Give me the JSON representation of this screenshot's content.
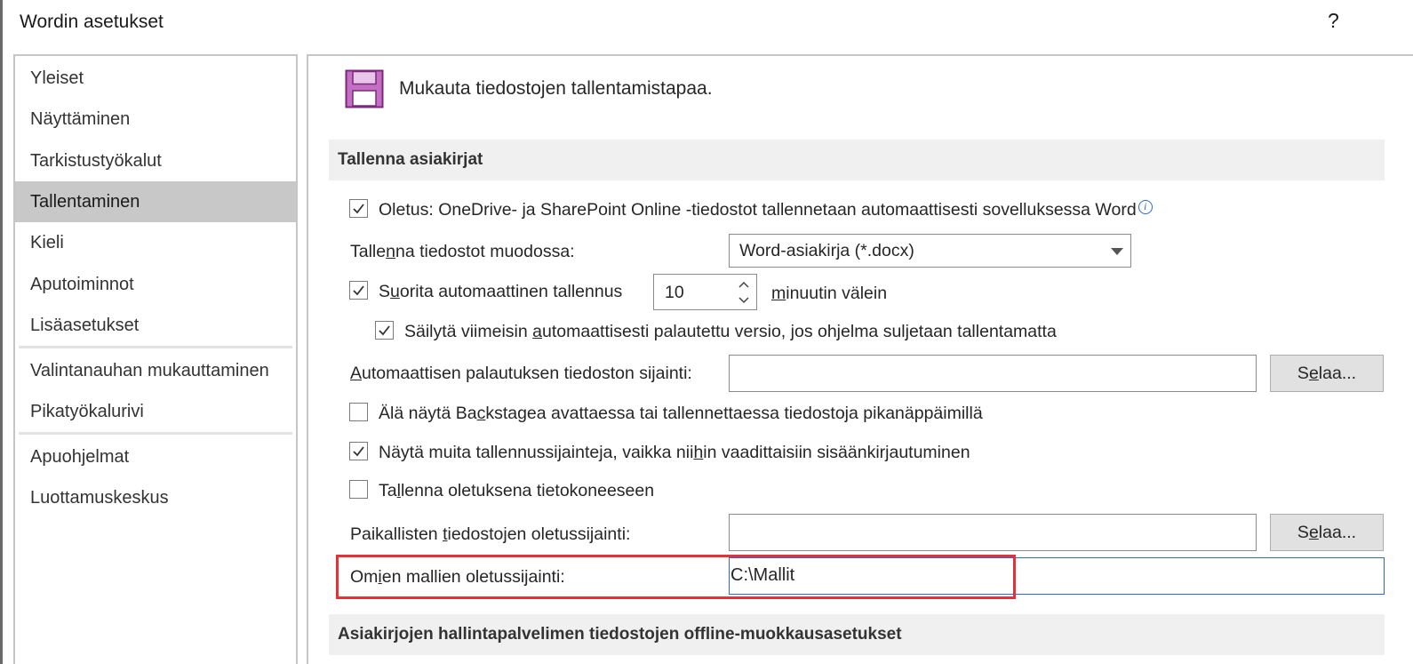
{
  "window": {
    "title": "Wordin asetukset",
    "help_label": "?"
  },
  "sidebar": {
    "items": [
      {
        "label": "Yleiset"
      },
      {
        "label": "Näyttäminen"
      },
      {
        "label": "Tarkistustyökalut"
      },
      {
        "label": "Tallentaminen",
        "selected": true
      },
      {
        "label": "Kieli"
      },
      {
        "label": "Aputoiminnot"
      },
      {
        "label": "Lisäasetukset"
      },
      {
        "label": "Valintanauhan mukauttaminen"
      },
      {
        "label": "Pikatyökalurivi"
      },
      {
        "label": "Apuohjelmat"
      },
      {
        "label": "Luottamuskeskus"
      }
    ]
  },
  "main": {
    "intro_icon": "save-floppy-icon",
    "intro_text": "Mukauta tiedostojen tallentamistapaa.",
    "section_save": {
      "header": "Tallenna asiakirjat",
      "autosave_default": {
        "label": "Oletus: OneDrive- ja SharePoint Online -tiedostot tallennetaan automaattisesti sovelluksessa Word",
        "checked": true,
        "info_icon": "i"
      },
      "save_format": {
        "label_pre": "Talle",
        "label_u": "n",
        "label_post": "na tiedostot muodossa:",
        "value": "Word-asiakirja (*.docx)"
      },
      "autorecover": {
        "label_pre": "S",
        "label_u": "u",
        "label_post": "orita automaattinen tallennus",
        "checked": true,
        "minutes": "10",
        "suffix_u": "m",
        "suffix_post": "inuutin välein"
      },
      "keep_last": {
        "label_pre": "Säilytä viimeisin ",
        "label_u": "a",
        "label_post": "utomaattisesti palautettu versio, jos ohjelma suljetaan tallentamatta",
        "checked": true
      },
      "autorecover_location": {
        "label_u": "A",
        "label_post": "utomaattisen palautuksen tiedoston sijainti:",
        "value": "",
        "browse_pre": "S",
        "browse_u": "e",
        "browse_post": "laa..."
      },
      "no_backstage": {
        "label_pre": "Älä näytä Ba",
        "label_u": "c",
        "label_post": "kstagea avattaessa tai tallennettaessa tiedostoja pikanäppäimillä",
        "checked": false
      },
      "show_additional": {
        "label_pre": "Näytä muita tallennussijainteja, vaikka nii",
        "label_u": "h",
        "label_post": "in vaadittaisiin sisäänkirjautuminen",
        "checked": true
      },
      "save_to_computer": {
        "label_pre": "Ta",
        "label_u": "l",
        "label_post": "lenna oletuksena tietokoneeseen",
        "checked": false
      },
      "local_location": {
        "label_pre": "Paikallisten ",
        "label_u": "t",
        "label_post": "iedostojen oletussijainti:",
        "value": "",
        "browse_pre": "S",
        "browse_u": "e",
        "browse_post": "laa..."
      },
      "templates_location": {
        "label_pre": "Om",
        "label_u": "i",
        "label_post": "en mallien oletussijainti:",
        "value": "C:\\Mallit"
      }
    },
    "section_offline": {
      "header": "Asiakirjojen hallintapalvelimen tiedostojen offline-muokkausasetukset"
    }
  },
  "colors": {
    "selected_nav": "#c8c8c8",
    "section_bg": "#f0f0f0",
    "focus_border": "#2b6cc4",
    "highlight": "#e53238",
    "icon_purple": "#9b3c9b"
  }
}
